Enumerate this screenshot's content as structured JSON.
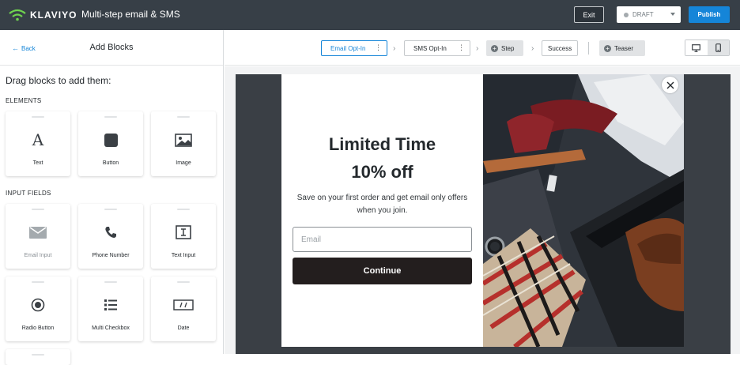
{
  "topbar": {
    "logo_text": "KLAVIYO",
    "title": "Multi-step email & SMS",
    "exit_label": "Exit",
    "status_label": "DRAFT",
    "publish_label": "Publish",
    "brand_color": "#1585d8",
    "bar_color": "#373f47"
  },
  "sidebar": {
    "back_label": "Back",
    "title": "Add Blocks",
    "drag_title": "Drag blocks to add them:",
    "elements_label": "ELEMENTS",
    "elements": [
      {
        "label": "Text",
        "icon": "text-icon"
      },
      {
        "label": "Button",
        "icon": "button-icon"
      },
      {
        "label": "Image",
        "icon": "image-icon"
      }
    ],
    "input_fields_label": "INPUT FIELDS",
    "input_fields": [
      {
        "label": "Email Input",
        "icon": "email-icon",
        "disabled": true
      },
      {
        "label": "Phone Number",
        "icon": "phone-icon"
      },
      {
        "label": "Text Input",
        "icon": "text-input-icon"
      },
      {
        "label": "Radio Button",
        "icon": "radio-icon"
      },
      {
        "label": "Multi Checkbox",
        "icon": "list-icon"
      },
      {
        "label": "Date",
        "icon": "date-icon"
      }
    ]
  },
  "steps": {
    "items": [
      {
        "label": "Email Opt-In",
        "active": true
      },
      {
        "label": "SMS Opt-In"
      },
      {
        "label": "Step",
        "type": "add"
      },
      {
        "label": "Success"
      },
      {
        "label": "Teaser",
        "type": "add"
      }
    ],
    "device_icons": [
      "desktop-icon",
      "mobile-icon"
    ]
  },
  "form": {
    "headline_1": "Limited Time",
    "headline_2": "10% off",
    "subtext": "Save on your first order and get email only offers when you join.",
    "email_placeholder": "Email",
    "button_label": "Continue",
    "button_color": "#231e1e"
  }
}
